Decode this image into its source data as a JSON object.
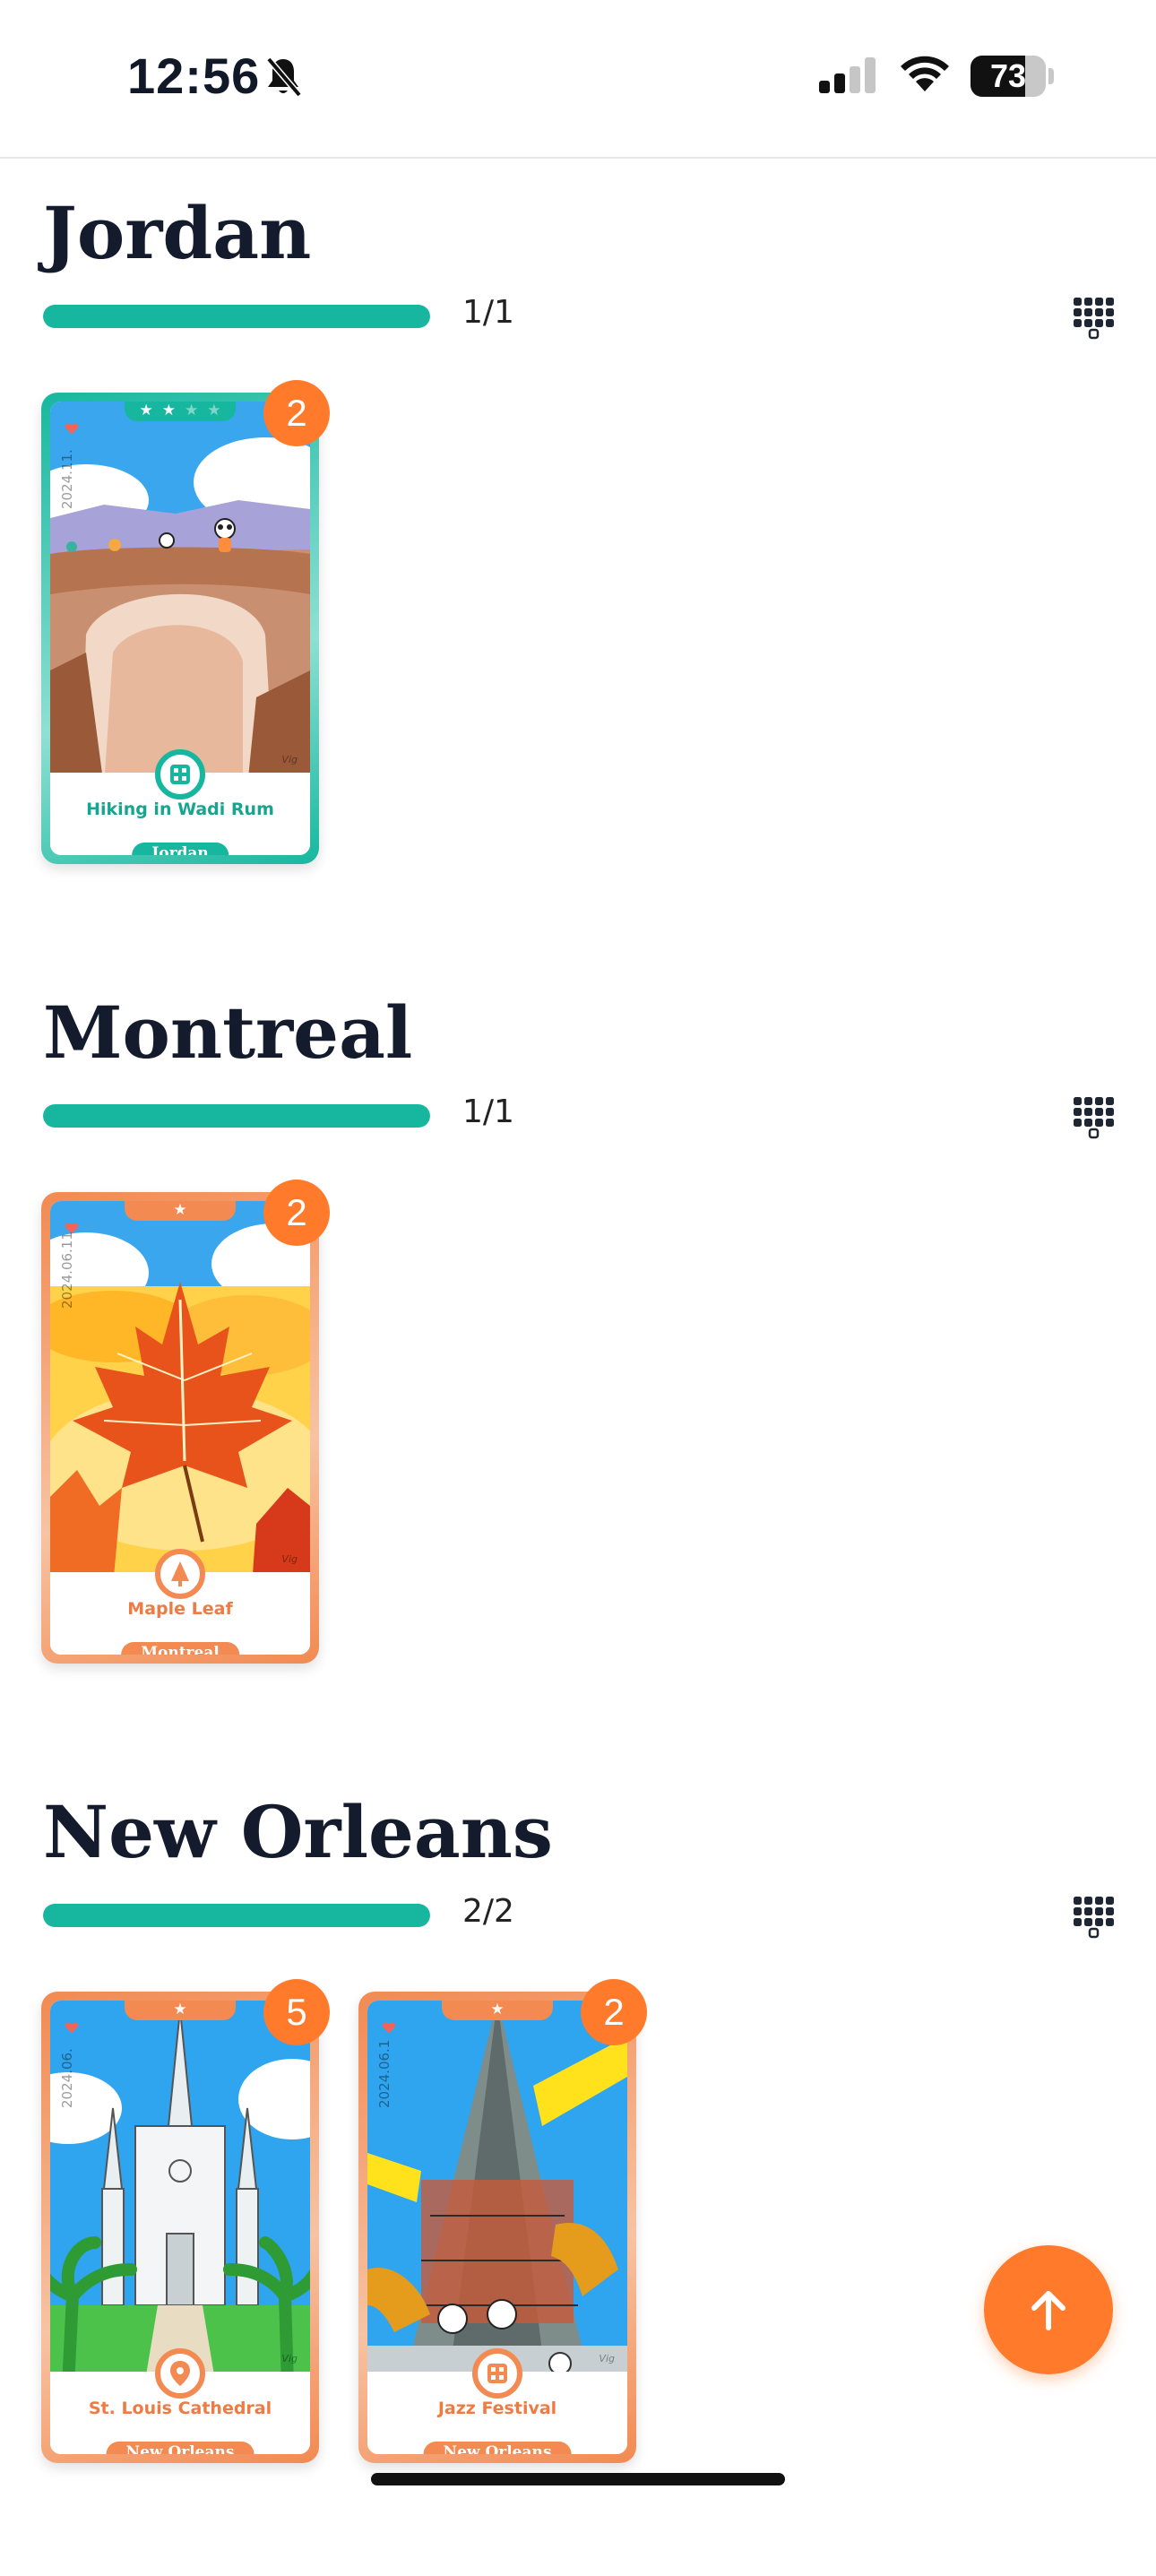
{
  "status_bar": {
    "time": "12:56",
    "battery_percent": "73",
    "battery_level": 0.73,
    "signal_bars_active": 2
  },
  "colors": {
    "teal": "#17b79f",
    "orange": "#ff7a2b",
    "title": "#141b2d"
  },
  "sections": [
    {
      "title": "Jordan",
      "progress_text": "1/1",
      "progress": 1.0,
      "cards": [
        {
          "name": "Hiking in Wadi Rum",
          "region": "Jordan",
          "date": "2024.11.",
          "badge": "2",
          "theme": "teal",
          "stars": 4,
          "stars_filled": 2,
          "icon": "grid-icon"
        }
      ]
    },
    {
      "title": "Montreal",
      "progress_text": "1/1",
      "progress": 1.0,
      "cards": [
        {
          "name": "Maple Leaf",
          "region": "Montreal",
          "date": "2024.06.11",
          "badge": "2",
          "theme": "orange",
          "stars": 1,
          "stars_filled": 1,
          "icon": "tree-icon"
        }
      ]
    },
    {
      "title": "New Orleans",
      "progress_text": "2/2",
      "progress": 1.0,
      "cards": [
        {
          "name": "St. Louis Cathedral",
          "region": "New Orleans",
          "date": "2024.06.",
          "badge": "5",
          "theme": "orange",
          "stars": 1,
          "stars_filled": 1,
          "icon": "pin-icon"
        },
        {
          "name": "Jazz Festival",
          "region": "New Orleans",
          "date": "2024.06.1",
          "badge": "2",
          "theme": "orange",
          "stars": 1,
          "stars_filled": 1,
          "icon": "grid-icon"
        }
      ]
    }
  ],
  "card_signature": "Vig",
  "fab": {
    "icon": "arrow-up-icon"
  }
}
